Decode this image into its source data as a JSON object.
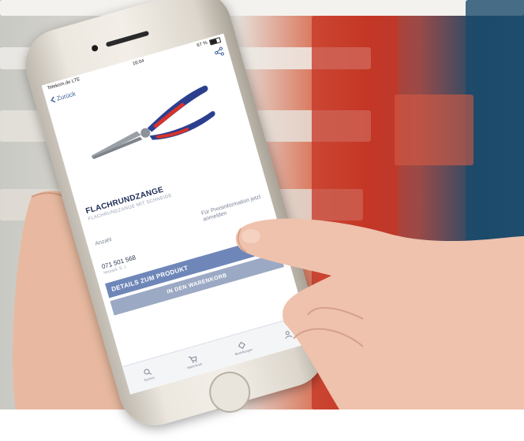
{
  "status_bar": {
    "carrier": "Telekom.de LTE",
    "time": "16:04",
    "battery": "67 %"
  },
  "nav": {
    "back_label": "Zurück"
  },
  "product": {
    "name": "FLACHRUNDZANGE",
    "subtitle": "FLACHRUNDZANGE MIT SCHNEIDE",
    "quantity_label": "Anzahl",
    "price_info": "Für Preisinformation jetzt anmelden",
    "article_number": "071 501 568",
    "article_sub": "Verpack. E: 1"
  },
  "buttons": {
    "details": "DETAILS ZUM PRODUKT",
    "cart": "IN DEN WARENKORB"
  },
  "tabs": [
    {
      "label": "Suchen",
      "icon": "search-icon"
    },
    {
      "label": "Warenkorb",
      "icon": "cart-icon"
    },
    {
      "label": "Bestellungen",
      "icon": "orders-icon"
    },
    {
      "label": "",
      "icon": "user-icon"
    }
  ],
  "colors": {
    "accent": "#3a5f9c",
    "title": "#1d2b55",
    "plier_handle_red": "#d8332a",
    "plier_handle_blue": "#2c3f8f"
  }
}
